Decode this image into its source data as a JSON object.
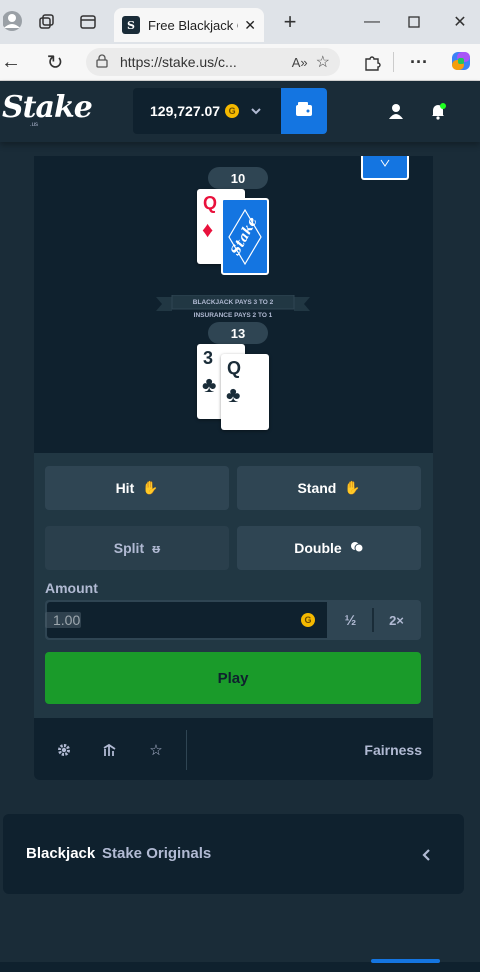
{
  "browser": {
    "tab_title": "Free Blackjack Or",
    "tab_favicon": "S",
    "url": "https://stake.us/c..."
  },
  "header": {
    "logo": "Stake",
    "logo_sub": ".us",
    "balance": "129,727.07",
    "coin": "G"
  },
  "dealer": {
    "score": "10",
    "cards": [
      {
        "rank": "Q",
        "suit": "♦"
      }
    ],
    "back_logo": "Stake"
  },
  "table_text": {
    "line1": "BLACKJACK PAYS 3 TO 2",
    "line2": "INSURANCE PAYS 2 TO 1"
  },
  "player": {
    "score": "13",
    "cards": [
      {
        "rank": "3",
        "suit": "♣"
      },
      {
        "rank": "Q",
        "suit": "♣"
      }
    ]
  },
  "actions": {
    "hit": "Hit",
    "stand": "Stand",
    "split": "Split",
    "double": "Double"
  },
  "amount": {
    "label": "Amount",
    "placeholder": "1.00",
    "coin": "G",
    "half": "½",
    "double": "2×"
  },
  "play_label": "Play",
  "footer": {
    "fairness": "Fairness"
  },
  "section": {
    "title": "Blackjack",
    "subtitle": "Stake Originals"
  },
  "colors": {
    "accent_blue": "#1475e1",
    "play_green": "#1a9b2a",
    "bg": "#1a2c38",
    "panel": "#0f212e"
  }
}
